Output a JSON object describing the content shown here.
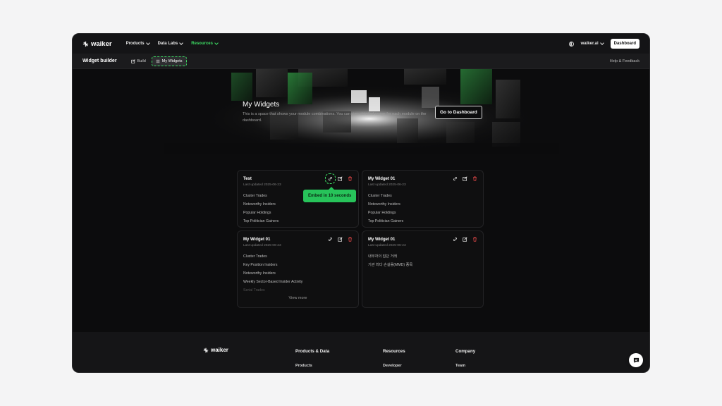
{
  "nav": {
    "logo": "waiker",
    "menu": [
      {
        "label": "Products"
      },
      {
        "label": "Data Labs"
      },
      {
        "label": "Resources"
      }
    ],
    "account": "waiker.ai",
    "dashboard_btn": "Dashboard",
    "accent": "#3ddc63"
  },
  "subnav": {
    "title": "Widget builder",
    "tabs": [
      {
        "label": "Build"
      },
      {
        "label": "My Widgets"
      }
    ],
    "help": "Help & Feedback"
  },
  "hero": {
    "title": "My Widgets",
    "description": "This is a space that shows your module combinations. You can view detailed usage for each module on the dashboard.",
    "button": "Go to Dashboard"
  },
  "cards": [
    {
      "title": "Test",
      "date": "Last updated 2025-06-23",
      "items": [
        "Cluster Trades",
        "Noteworthy Insiders",
        "Popular Holdings",
        "Top Politician Gainers"
      ]
    },
    {
      "title": "My Widget 01",
      "date": "Last updated 2025-06-23",
      "items": [
        "Cluster Trades",
        "Noteworthy Insiders",
        "Popular Holdings",
        "Top Politician Gainers"
      ]
    },
    {
      "title": "My Widget 01",
      "date": "Last updated 2025-06-23",
      "items": [
        "Cluster Trades",
        "Key Position Insiders",
        "Noteworthy Insiders",
        "Weekly Sector-Based Insider Activity",
        "Serial Trades"
      ],
      "view_more": "View more"
    },
    {
      "title": "My Widget 01",
      "date": "Last updated 2025-06-23",
      "items": [
        "내부자의 집단 거래",
        "기관 최다 손실률(MMD) 종목"
      ]
    }
  ],
  "tooltip": "Embed in 10 seconds",
  "footer": {
    "logo": "waiker",
    "columns": [
      {
        "heading": "Products & Data",
        "sub": "Products"
      },
      {
        "heading": "Resources",
        "sub": "Developer"
      },
      {
        "heading": "Company",
        "sub": "Team"
      }
    ]
  }
}
